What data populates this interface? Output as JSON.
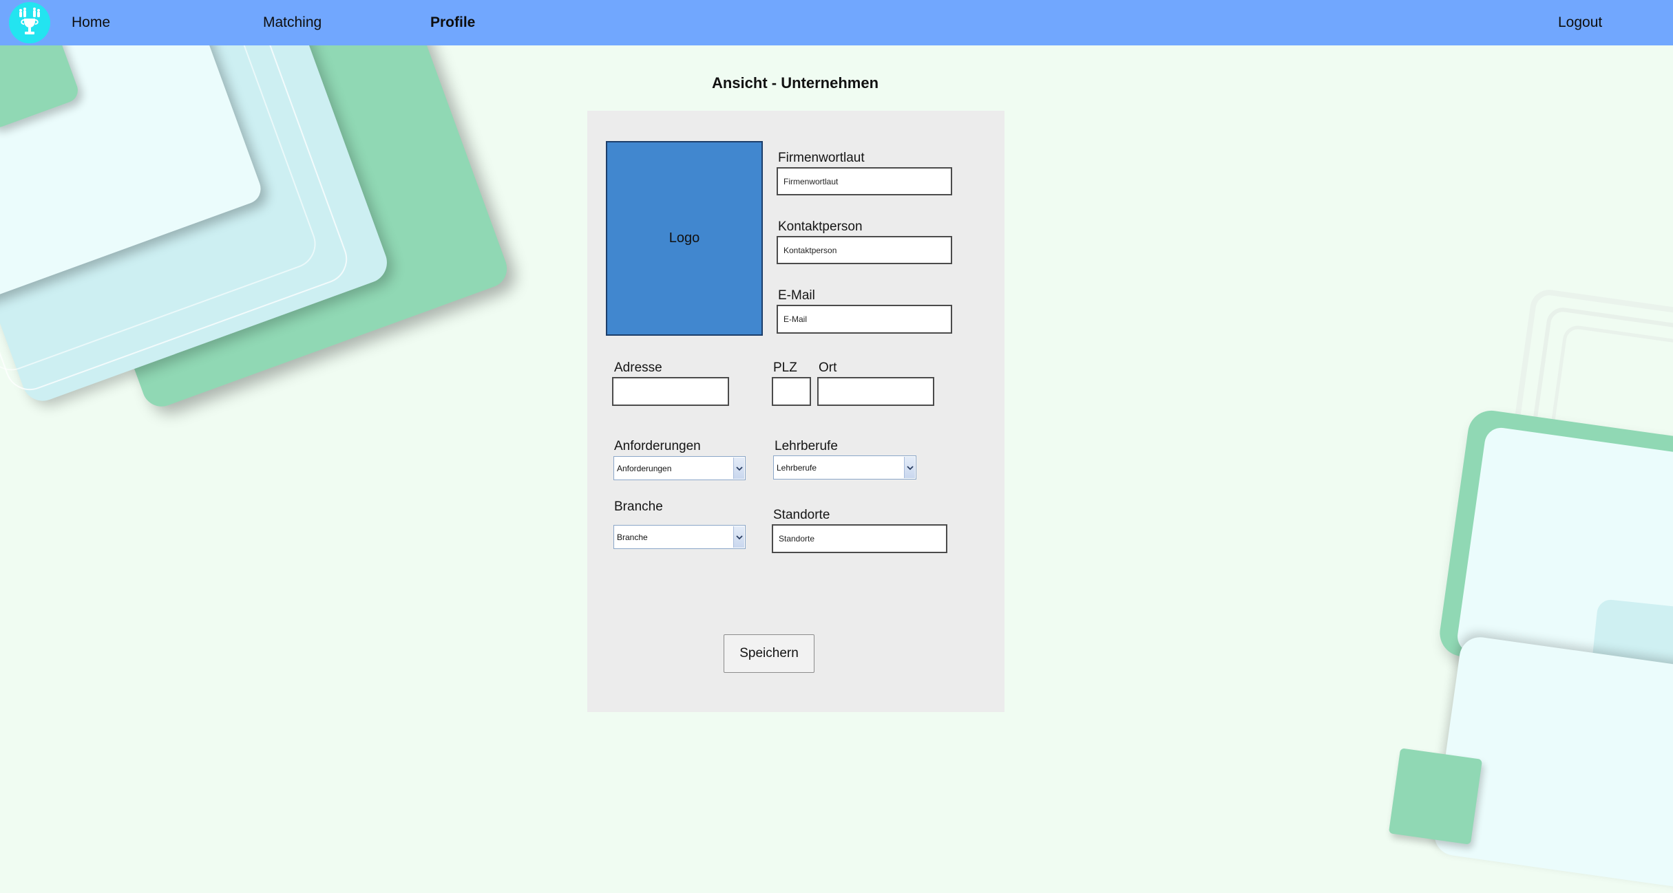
{
  "nav": {
    "logo_icon": "trophy-logo-icon",
    "home": "Home",
    "matching": "Matching",
    "profile": "Profile",
    "logout": "Logout"
  },
  "page": {
    "title": "Ansicht - Unternehmen"
  },
  "form": {
    "logo_label": "Logo",
    "firmenwortlaut": {
      "label": "Firmenwortlaut",
      "placeholder": "Firmenwortlaut"
    },
    "kontaktperson": {
      "label": "Kontaktperson",
      "placeholder": "Kontaktperson"
    },
    "email": {
      "label": "E-Mail",
      "placeholder": "E-Mail"
    },
    "adresse": {
      "label": "Adresse",
      "placeholder": ""
    },
    "plz": {
      "label": "PLZ",
      "placeholder": ""
    },
    "ort": {
      "label": "Ort",
      "placeholder": ""
    },
    "anforderungen": {
      "label": "Anforderungen",
      "selected": "Anforderungen"
    },
    "lehrberufe": {
      "label": "Lehrberufe",
      "selected": "Lehrberufe"
    },
    "branche": {
      "label": "Branche",
      "selected": "Branche"
    },
    "standorte": {
      "label": "Standorte",
      "placeholder": "Standorte"
    },
    "save": "Speichern"
  },
  "colors": {
    "navbar": "#71a7fe",
    "logo_circle": "#23e4f0",
    "logo_box": "#4187cf",
    "panel": "#ececec",
    "page_background": "#f0fcf2",
    "decor_green": "#90d8b4"
  }
}
